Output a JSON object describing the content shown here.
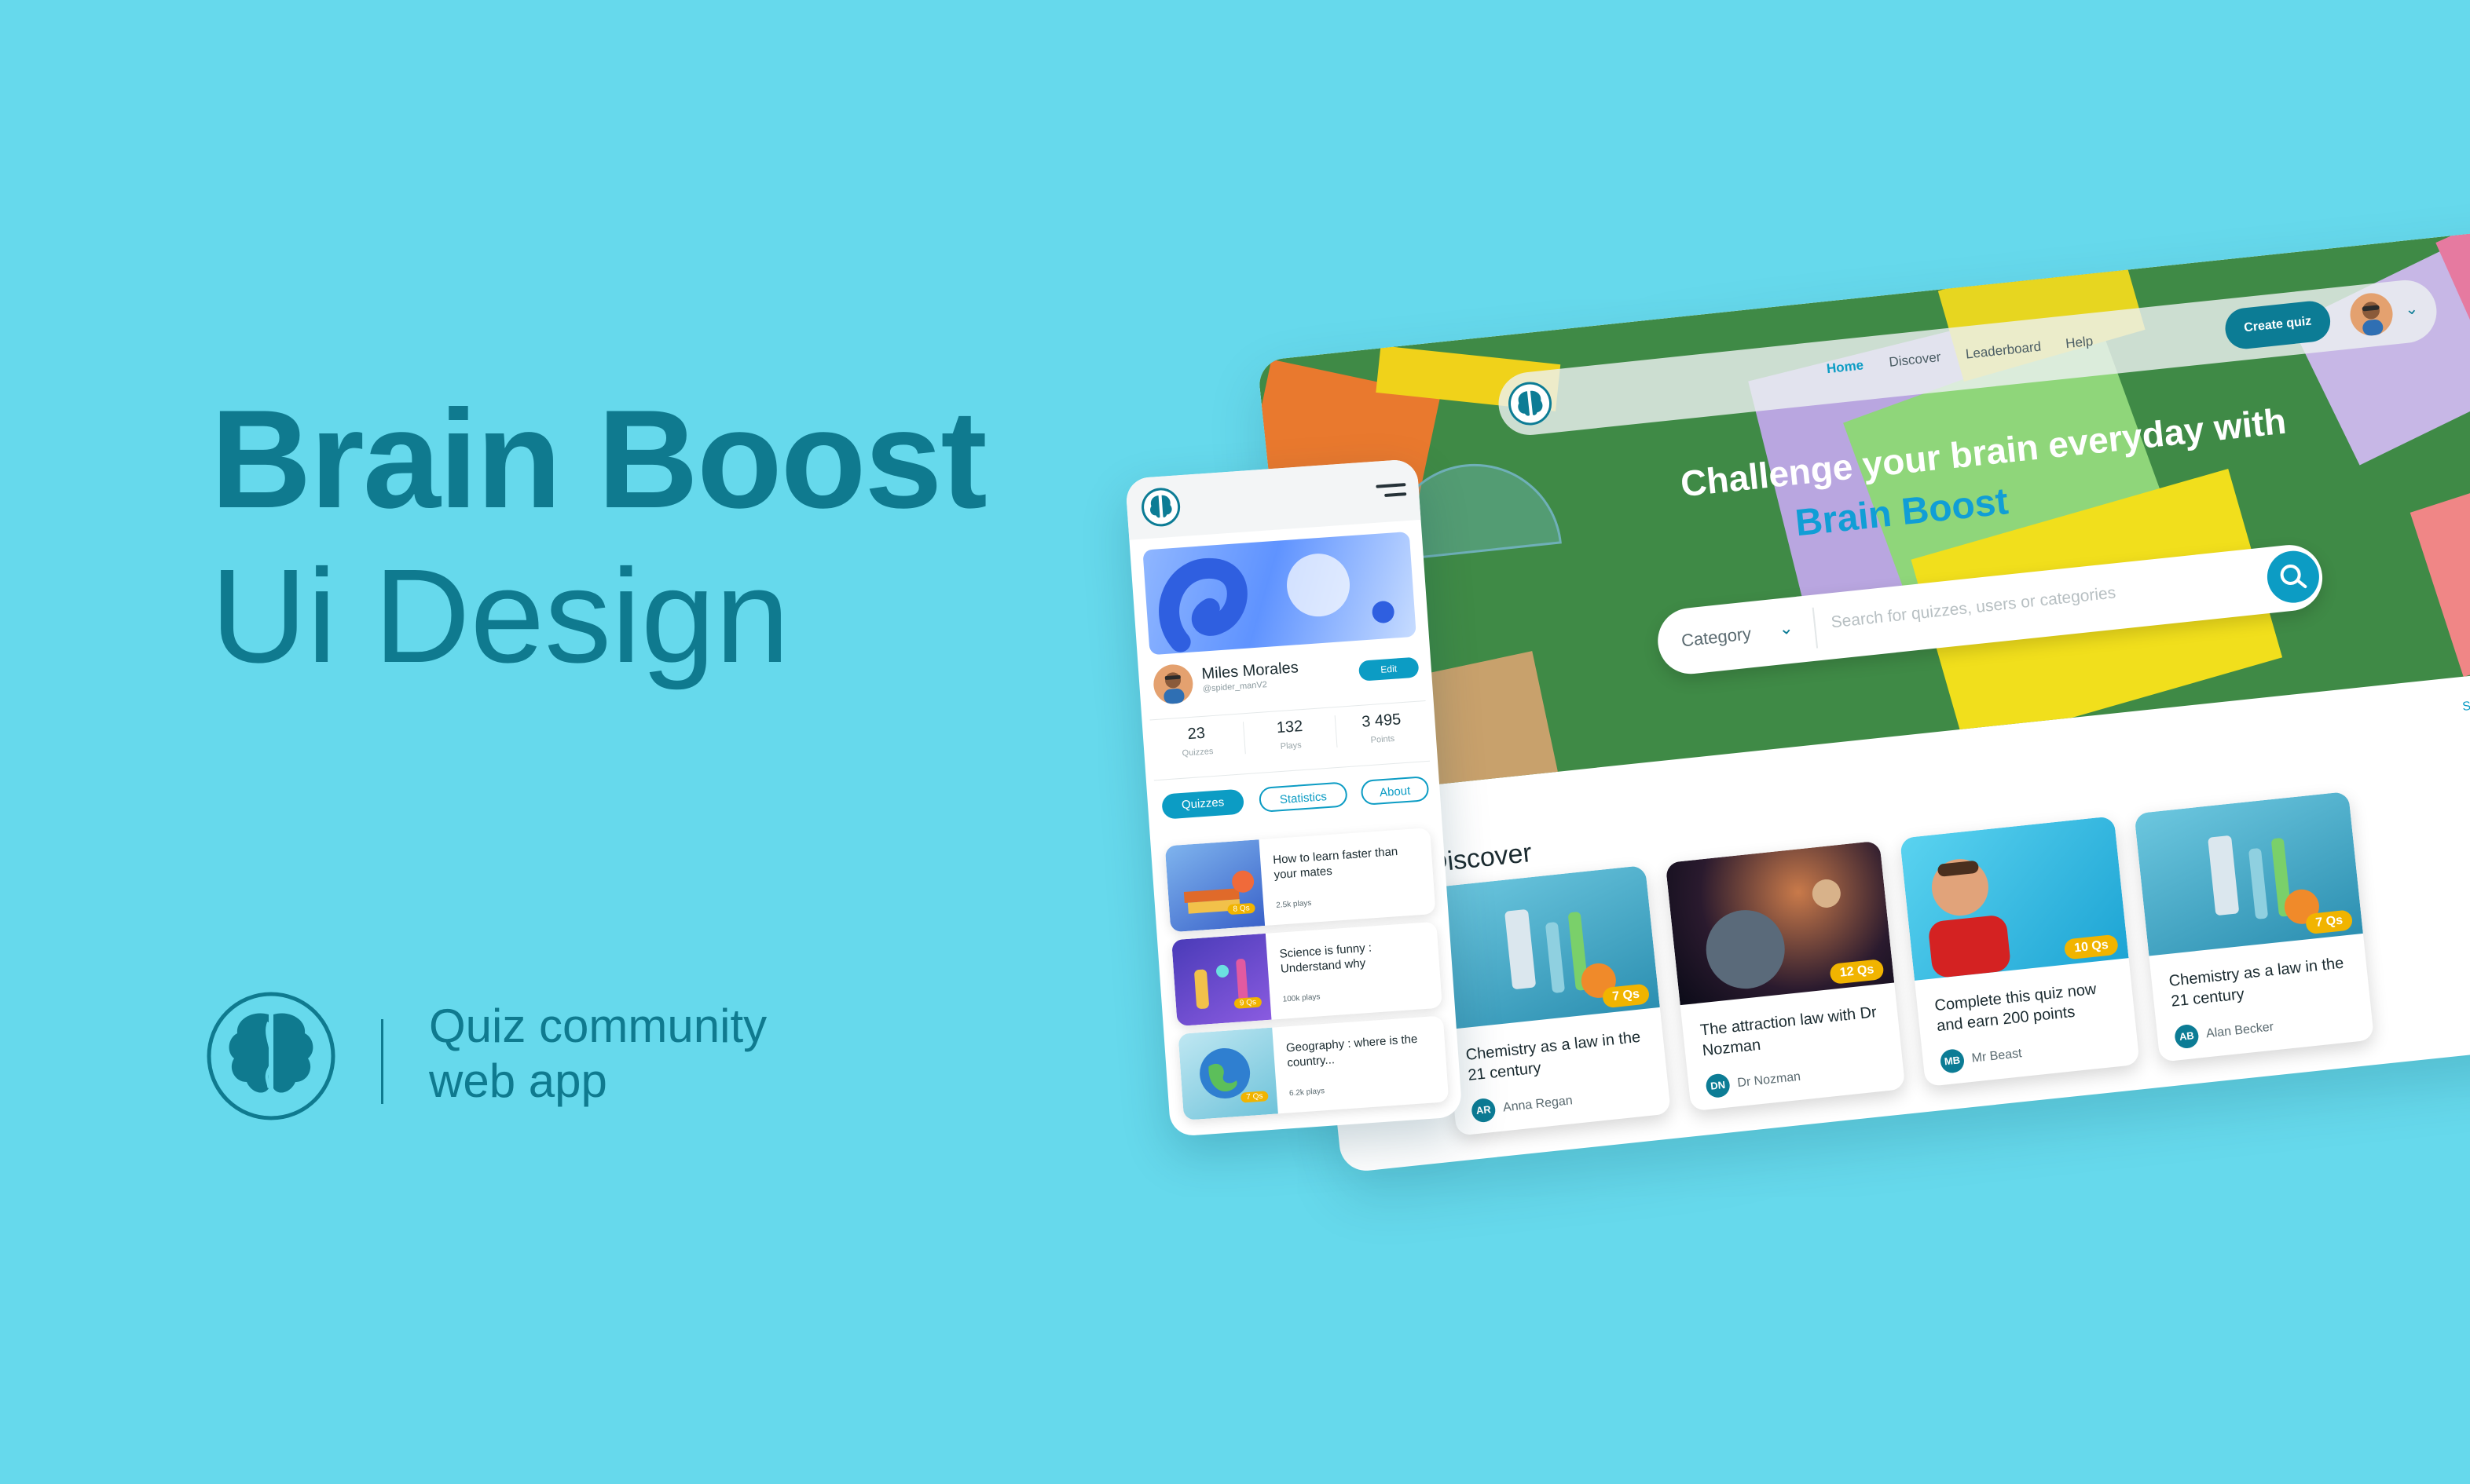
{
  "hero_text": {
    "title": "Brain Boost",
    "subtitle": "Ui Design",
    "tagline_line1": "Quiz community",
    "tagline_line2": "web app"
  },
  "desktop": {
    "nav": {
      "home": "Home",
      "discover": "Discover",
      "leaderboard": "Leaderboard",
      "help": "Help",
      "create_quiz": "Create quiz"
    },
    "hero": {
      "title": "Challenge your brain everyday with",
      "brand": "Brain Boost"
    },
    "search": {
      "category": "Category",
      "placeholder": "Search for quizzes, users or categories"
    },
    "see_more": "See more",
    "discover_title": "Discover",
    "cards": [
      {
        "title": "Chemistry as a law in the 21 century",
        "badge": "7 Qs",
        "initials": "AR",
        "author": "Anna Regan"
      },
      {
        "title": "The attraction law with Dr Nozman",
        "badge": "12 Qs",
        "initials": "DN",
        "author": "Dr Nozman"
      },
      {
        "title": "Complete this quiz now and earn 200 points",
        "badge": "10 Qs",
        "initials": "MB",
        "author": "Mr Beast"
      },
      {
        "title": "Chemistry as a law in the 21 century",
        "badge": "7 Qs",
        "initials": "AB",
        "author": "Alan Becker"
      }
    ]
  },
  "mobile": {
    "profile": {
      "name": "Miles Morales",
      "handle": "@spider_manV2",
      "edit": "Edit"
    },
    "stats": [
      {
        "value": "23",
        "label": "Quizzes"
      },
      {
        "value": "132",
        "label": "Plays"
      },
      {
        "value": "3 495",
        "label": "Points"
      }
    ],
    "tabs": {
      "quizzes": "Quizzes",
      "statistics": "Statistics",
      "about": "About"
    },
    "items": [
      {
        "title": "How to learn faster than your mates",
        "plays": "2.5k plays",
        "badge": "8 Qs"
      },
      {
        "title": "Science is funny : Understand why",
        "plays": "100k plays",
        "badge": "9 Qs"
      },
      {
        "title": "Geography : where is the country...",
        "plays": "6.2k plays",
        "badge": "7 Qs"
      }
    ]
  },
  "colors": {
    "background": "#66d9ec",
    "brand_dark": "#0f7a8f",
    "accent": "#0c9cc4",
    "badge": "#f1b400"
  }
}
